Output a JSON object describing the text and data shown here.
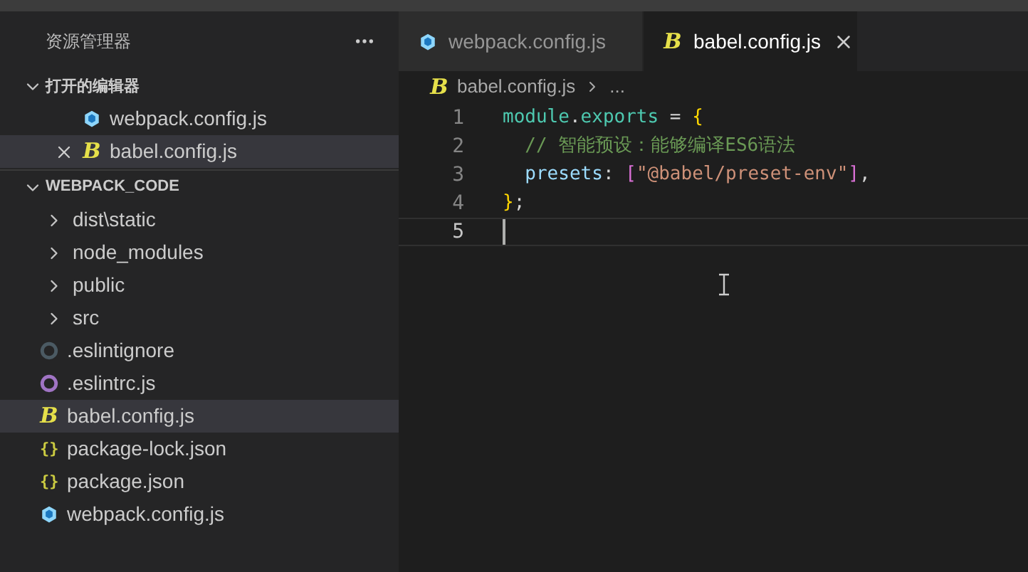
{
  "sidebar": {
    "title": "资源管理器",
    "open_editors": {
      "title": "打开的编辑器",
      "expanded": true,
      "items": [
        {
          "name": "webpack.config.js",
          "kind": "webpack",
          "selected": false
        },
        {
          "name": "babel.config.js",
          "kind": "babel",
          "icon": "B",
          "selected": true
        }
      ]
    },
    "project": {
      "title": "WEBPACK_CODE",
      "expanded": true,
      "items": [
        {
          "name": "dist\\static",
          "kind": "folder",
          "expanded": false,
          "selected": false
        },
        {
          "name": "node_modules",
          "kind": "folder",
          "expanded": false,
          "selected": false
        },
        {
          "name": "public",
          "kind": "folder",
          "expanded": false,
          "selected": false
        },
        {
          "name": "src",
          "kind": "folder",
          "expanded": false,
          "selected": false
        },
        {
          "name": ".eslintignore",
          "kind": "eslintignore",
          "selected": false
        },
        {
          "name": ".eslintrc.js",
          "kind": "eslintrc",
          "selected": false
        },
        {
          "name": "babel.config.js",
          "kind": "babel",
          "icon": "B",
          "selected": true
        },
        {
          "name": "package-lock.json",
          "kind": "json",
          "icon": "{}",
          "selected": false
        },
        {
          "name": "package.json",
          "kind": "json",
          "icon": "{}",
          "selected": false
        },
        {
          "name": "webpack.config.js",
          "kind": "webpack",
          "selected": false
        }
      ]
    }
  },
  "tabs": [
    {
      "label": "webpack.config.js",
      "kind": "webpack",
      "selected": false
    },
    {
      "label": "babel.config.js",
      "kind": "babel",
      "icon": "B",
      "selected": true
    }
  ],
  "breadcrumb": {
    "kind": "babel",
    "icon": "B",
    "file": "babel.config.js",
    "rest": "..."
  },
  "editor": {
    "lines": [
      {
        "number": "1",
        "current": false,
        "tokens": [
          {
            "kind": "variable",
            "text": "module"
          },
          {
            "kind": "punct",
            "text": "."
          },
          {
            "kind": "variable",
            "text": "exports"
          },
          {
            "kind": "punct",
            "text": " = "
          },
          {
            "kind": "brace",
            "text": "{"
          }
        ]
      },
      {
        "number": "2",
        "current": false,
        "tokens": [
          {
            "kind": "comment",
            "text": "  // 智能预设：能够编译ES6语法"
          }
        ]
      },
      {
        "number": "3",
        "current": false,
        "tokens": [
          {
            "kind": "property",
            "text": "  presets"
          },
          {
            "kind": "punct",
            "text": ": "
          },
          {
            "kind": "bracket",
            "text": "["
          },
          {
            "kind": "string",
            "text": "\"@babel/preset-env\""
          },
          {
            "kind": "bracket",
            "text": "]"
          },
          {
            "kind": "punct",
            "text": ","
          }
        ]
      },
      {
        "number": "4",
        "current": false,
        "tokens": [
          {
            "kind": "brace",
            "text": "}"
          },
          {
            "kind": "punct",
            "text": ";"
          }
        ]
      },
      {
        "number": "5",
        "current": true
      }
    ]
  }
}
